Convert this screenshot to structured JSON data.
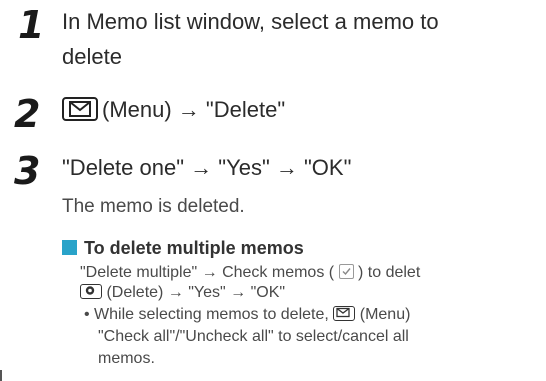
{
  "steps": [
    {
      "number": "1",
      "line1": "In Memo list window, select a memo to",
      "line2": "delete"
    },
    {
      "number": "2",
      "menu_label": "(Menu) → \"Delete\""
    },
    {
      "number": "3",
      "text": "\"Delete one\" → \"Yes\" → \"OK\""
    }
  ],
  "result": "The memo is deleted.",
  "subsection": {
    "heading": "To delete multiple memos",
    "accent_color": "#29a3c9",
    "line1_a": "\"Delete multiple\" → Check memos (",
    "line1_b": ") to delet",
    "line2": "(Delete) → \"Yes\" → \"OK\"",
    "bullet_line1": "(Menu)",
    "bullet_prefix": "• While selecting memos to delete,",
    "bullet_line2": "\"Check all\"/\"Uncheck all\" to select/cancel all",
    "bullet_line3": "memos."
  },
  "icons": {
    "menu_key": "envelope-menu-key-icon",
    "center_key": "center-select-key-icon",
    "checkbox": "checked-checkbox-icon"
  }
}
